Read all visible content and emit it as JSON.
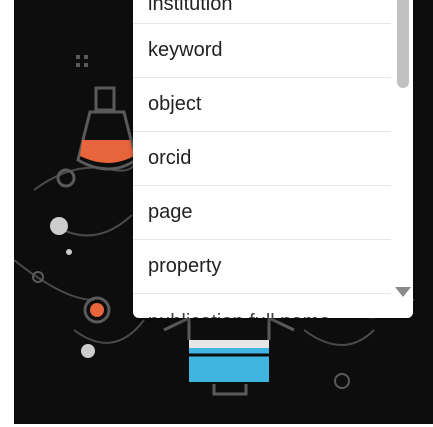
{
  "dropdown": {
    "items": [
      {
        "label": "institution"
      },
      {
        "label": "keyword"
      },
      {
        "label": "object"
      },
      {
        "label": "orcid"
      },
      {
        "label": "page"
      },
      {
        "label": "property"
      },
      {
        "label": "publication full name"
      }
    ]
  },
  "colors": {
    "background": "#0d0d0d",
    "accent_orange": "#e8643a",
    "accent_blue": "#3fb5e0",
    "line_grey": "#5a5a5a"
  },
  "icons": [
    "flask-icon",
    "briefcase-icon",
    "network-icon"
  ]
}
